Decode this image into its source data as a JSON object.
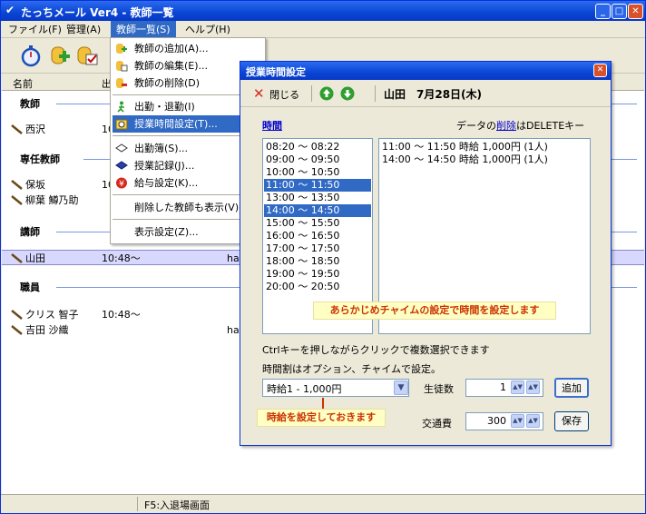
{
  "window": {
    "title": "たっちメール Ver4 - 教師一覧"
  },
  "menubar": {
    "items": [
      "ファイル(F)",
      "管理(A)",
      "教師一覧(S)",
      "ヘルプ(H)"
    ]
  },
  "list": {
    "headers": [
      "名前",
      "出"
    ],
    "groups": [
      {
        "label": "教師",
        "rows": [
          {
            "name": "西沢",
            "time": "10",
            "extra": ""
          }
        ]
      },
      {
        "label": "専任教師",
        "rows": [
          {
            "name": "保坂",
            "time": "10",
            "extra": ""
          },
          {
            "name": "柳葉 鱒乃助",
            "time": "",
            "extra": ""
          }
        ]
      },
      {
        "label": "講師",
        "rows": [
          {
            "name": "山田",
            "time": "10:48～",
            "extra": "ha"
          }
        ]
      },
      {
        "label": "職員",
        "rows": [
          {
            "name": "クリス 智子",
            "time": "10:48～",
            "extra": ""
          },
          {
            "name": "吉田 沙織",
            "time": "",
            "extra": "ha"
          }
        ]
      }
    ]
  },
  "statusbar": {
    "text": "F5:入退場画面"
  },
  "dropdown": {
    "items": [
      "教師の追加(A)...",
      "教師の編集(E)...",
      "教師の削除(D)",
      "出勤・退勤(I)",
      "授業時間設定(T)...",
      "出勤簿(S)...",
      "授業記録(J)...",
      "給与設定(K)...",
      "削除した教師も表示(V)",
      "表示設定(Z)..."
    ]
  },
  "dialog": {
    "title": "授業時間設定",
    "close_label": "閉じる",
    "teacher_date": "山田　7月28日(木)",
    "time_link": "時間",
    "delete_hint_prefix": "データの",
    "delete_hint_link": "削除",
    "delete_hint_suffix": "はDELETEキー",
    "time_slots": [
      "08:20 ～ 08:22",
      "09:00 ～ 09:50",
      "10:00 ～ 10:50",
      "11:00 ～ 11:50",
      "13:00 ～ 13:50",
      "14:00 ～ 14:50",
      "15:00 ～ 15:50",
      "16:00 ～ 16:50",
      "17:00 ～ 17:50",
      "18:00 ～ 18:50",
      "19:00 ～ 19:50",
      "20:00 ～ 20:50"
    ],
    "selected_slots": [
      "11:00 ～ 11:50",
      "14:00 ～ 14:50"
    ],
    "entries": [
      "11:00 ～ 11:50 時給 1,000円 (1人)",
      "14:00 ～ 14:50 時給 1,000円 (1人)"
    ],
    "chime_callout": "あらかじめチャイムの設定で時間を設定します",
    "help_line1": "Ctrlキーを押しながらクリックで複数選択できます",
    "help_line2": "時間割はオプション、チャイムで設定。",
    "rate_select": "時給1 - 1,000円",
    "rate_callout": "時給を設定しておきます",
    "students_label": "生徒数",
    "students_value": "1",
    "add_label": "追加",
    "transport_label": "交通費",
    "transport_value": "300",
    "save_label": "保存"
  },
  "colors": {
    "titlebar": "#0a45d4",
    "selection": "#316ac5",
    "callout_text": "#cc3300"
  }
}
